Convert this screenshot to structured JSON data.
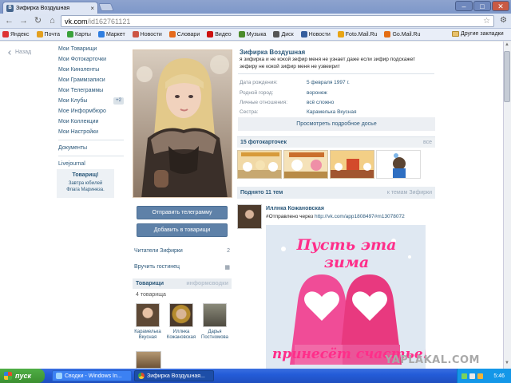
{
  "browser": {
    "tab_title": "Зифирка Воздушная",
    "tab_close": "×",
    "url_host": "vk.com",
    "url_path": "/id162761121",
    "star": "☆"
  },
  "bookmarks": [
    {
      "label": "Яндекс",
      "color": "#d33"
    },
    {
      "label": "Почта",
      "color": "#e3a020"
    },
    {
      "label": "Карты",
      "color": "#3aa13a"
    },
    {
      "label": "Маркет",
      "color": "#2f7ee0"
    },
    {
      "label": "Новости",
      "color": "#c54"
    },
    {
      "label": "Словари",
      "color": "#e56a1c"
    },
    {
      "label": "Видео",
      "color": "#c11"
    },
    {
      "label": "Музыка",
      "color": "#4b8b2a"
    },
    {
      "label": "Диск",
      "color": "#555"
    },
    {
      "label": "Новости",
      "color": "#345d9d"
    },
    {
      "label": "Foto.Mail.Ru",
      "color": "#e8a414"
    },
    {
      "label": "Go.Mail.Ru",
      "color": "#e46e14"
    }
  ],
  "bookmarks_other": "Другие закладки",
  "sidebar": {
    "back": "Назад",
    "items": [
      {
        "label": "Мои Товарищи"
      },
      {
        "label": "Мои Фотокарточки"
      },
      {
        "label": "Мои Киноленты"
      },
      {
        "label": "Мои Граммзаписи"
      },
      {
        "label": "Мои Телеграммы"
      },
      {
        "label": "Мои Клубы",
        "count": "+2"
      },
      {
        "label": "Мое Информбюро"
      },
      {
        "label": "Мои Коллекции"
      },
      {
        "label": "Мои Настройки"
      }
    ],
    "documents": "Документы",
    "livejournal": "Livejournal",
    "promo_title": "Товарищ!",
    "promo_line1": "Завтра юбилей",
    "promo_line2": "Флага Маринеза."
  },
  "profile": {
    "name": "Зифирка Воздушная",
    "status": "я зифирка и не кокой зефир меня не узнает даже если зифир подскажет зефиру не кокой зифир меня не узвеирит",
    "rows": [
      {
        "key": "Дата рождения:",
        "value": "5 февраля 1997 г."
      },
      {
        "key": "Родной город:",
        "value": "воронеж"
      },
      {
        "key": "Личные отношения:",
        "value": "всё сложно"
      },
      {
        "key": "Сестра:",
        "value": "Карамелька Вкусная"
      }
    ],
    "full_info": "Просмотреть подробное досье",
    "send_button": "Отправить телеграмму",
    "add_button": "Добавить в товарищи",
    "readers_label": "Читатели Зифирки",
    "readers_count": "2",
    "guests_label": "Вручить гостинец"
  },
  "friends": {
    "header": "Товарищи",
    "header_right": "информсводки",
    "count": "4 товарища",
    "list": [
      {
        "first": "Карамелька",
        "last": "Вкусная"
      },
      {
        "first": "Иллнка",
        "last": "Кожановская"
      },
      {
        "first": "Дарья",
        "last": "Постномова"
      }
    ]
  },
  "photos": {
    "header": "15 фотокарточек",
    "link": "все"
  },
  "wall": {
    "header": "Поднято 11 тем",
    "link": "к темам Зифирки",
    "post_author": "Иллнка Кожановская",
    "post_prefix": "#Отправлено через ",
    "post_link": "http://vk.com/app1808497#m13078072",
    "image_text_1": "Пусть эта зима",
    "image_text_2": "принесёт счастье!"
  },
  "watermark": "YAPLAKAL.COM",
  "taskbar": {
    "start": "пуск",
    "task1": "Сводки - Windows In...",
    "task2": "Зифирка Воздушная...",
    "clock": "5:46"
  }
}
